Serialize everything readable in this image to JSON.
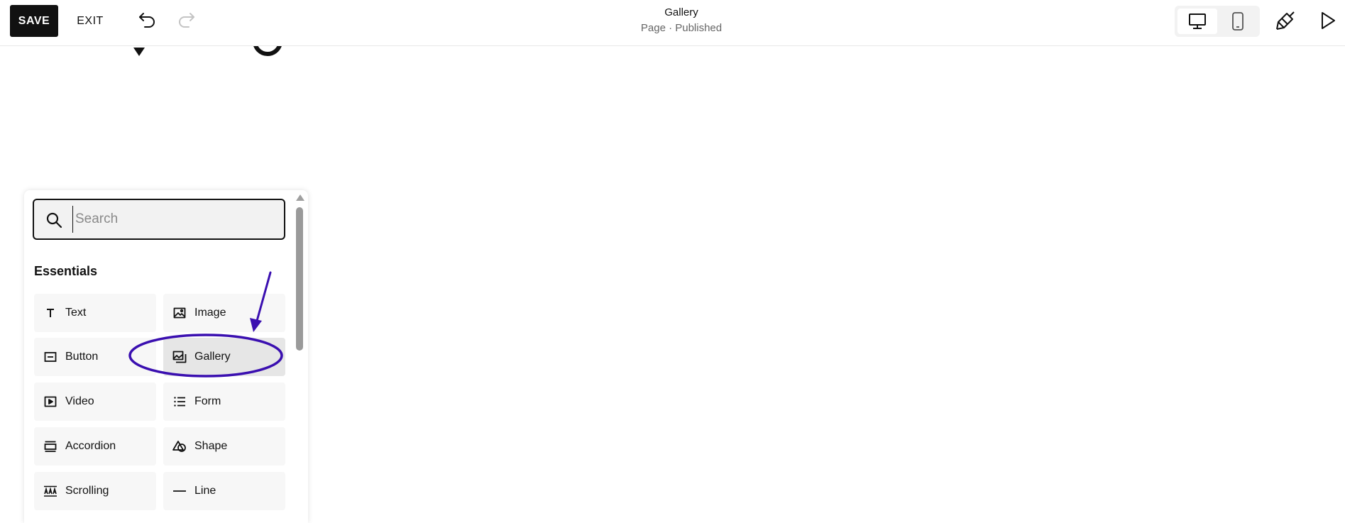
{
  "toolbar": {
    "save_label": "SAVE",
    "exit_label": "EXIT",
    "page_title": "Gallery",
    "page_status": "Page · Published"
  },
  "icons": {
    "undo": "undo-icon",
    "redo": "redo-icon",
    "desktop": "desktop-icon",
    "mobile": "mobile-icon",
    "style": "paintbrush-icon",
    "preview": "play-icon",
    "search": "search-icon"
  },
  "panel": {
    "search_placeholder": "Search",
    "search_value": "",
    "section_title": "Essentials",
    "blocks": [
      {
        "label": "Text",
        "icon": "text-icon"
      },
      {
        "label": "Image",
        "icon": "image-icon"
      },
      {
        "label": "Button",
        "icon": "button-icon"
      },
      {
        "label": "Gallery",
        "icon": "gallery-icon",
        "active": true
      },
      {
        "label": "Video",
        "icon": "video-icon"
      },
      {
        "label": "Form",
        "icon": "form-icon"
      },
      {
        "label": "Accordion",
        "icon": "accordion-icon"
      },
      {
        "label": "Shape",
        "icon": "shape-icon"
      },
      {
        "label": "Scrolling",
        "icon": "scrolling-icon"
      },
      {
        "label": "Line",
        "icon": "line-icon"
      }
    ]
  },
  "colors": {
    "save_bg": "#111111",
    "annotation": "#3a0fb0",
    "active_item": "#e6e6e6"
  }
}
